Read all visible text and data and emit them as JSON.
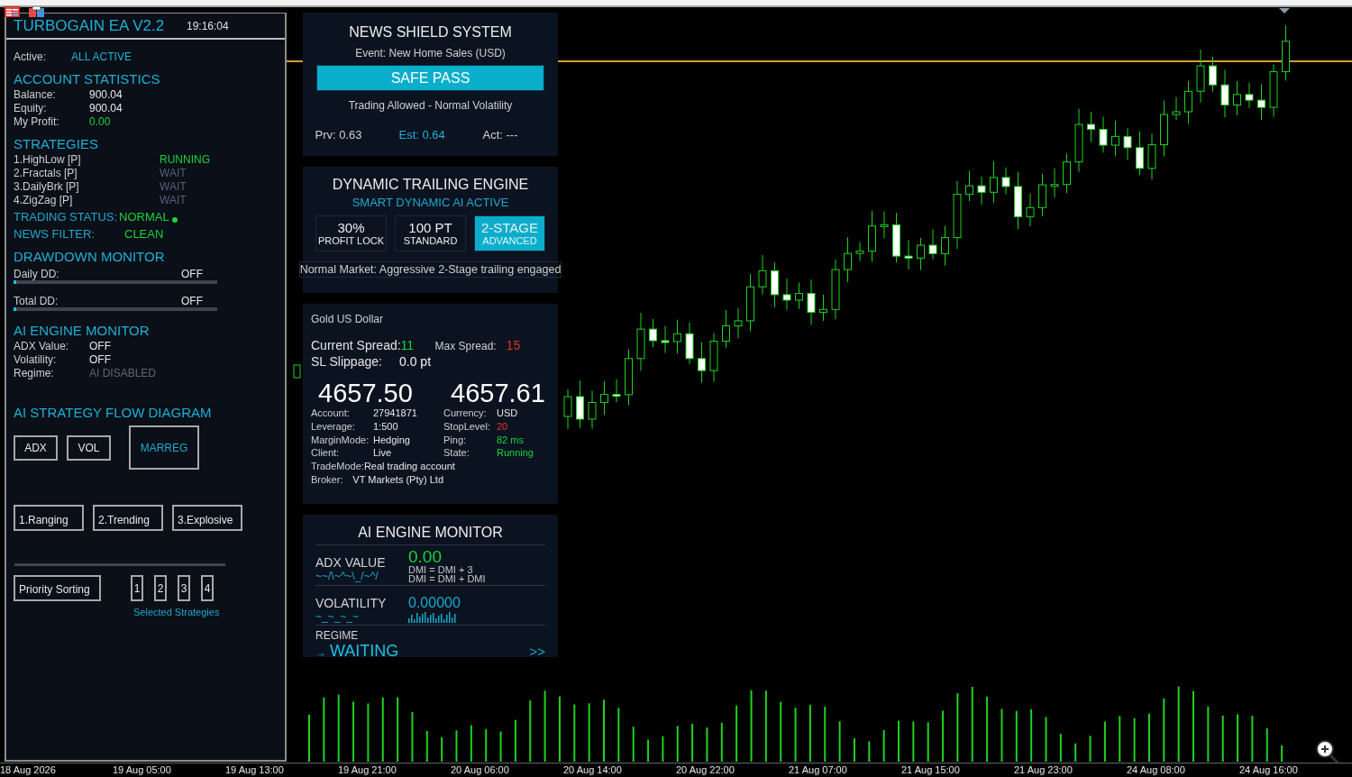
{
  "panel": {
    "title": "TURBOGAIN EA V2.2",
    "time": "19:16:04",
    "active_label": "Active:",
    "active_value": "ALL ACTIVE",
    "account": {
      "heading": "ACCOUNT STATISTICS",
      "rows": [
        {
          "label": "Balance:",
          "value": "900.04",
          "kind": "plain"
        },
        {
          "label": "Equity:",
          "value": "900.04",
          "kind": "plain"
        },
        {
          "label": "My Profit:",
          "value": "0.00",
          "kind": "good"
        }
      ]
    },
    "strategies": {
      "heading": "STRATEGIES",
      "items": [
        {
          "name": "1.HighLow [P]",
          "status": "RUNNING",
          "running": true
        },
        {
          "name": "2.Fractals [P]",
          "status": "WAIT",
          "running": false
        },
        {
          "name": "3.DailyBrk [P]",
          "status": "WAIT",
          "running": false
        },
        {
          "name": "4.ZigZag [P]",
          "status": "WAIT",
          "running": false
        }
      ]
    },
    "trading_status": {
      "label": "TRADING STATUS:",
      "value": "NORMAL"
    },
    "news_filter": {
      "label": "NEWS FILTER:",
      "value": "CLEAN"
    },
    "drawdown": {
      "heading": "DRAWDOWN MONITOR",
      "meters": [
        {
          "label": "Daily DD:",
          "reading": "OFF",
          "level": 0.01
        },
        {
          "label": "Total DD:",
          "reading": "OFF",
          "level": 0.01
        }
      ]
    },
    "ai_monitor": {
      "heading": "AI ENGINE MONITOR",
      "rows": [
        {
          "label": "ADX Value:",
          "value": "OFF",
          "disabled": false
        },
        {
          "label": "Volatility:",
          "value": "OFF",
          "disabled": false
        },
        {
          "label": "Regime:",
          "value": "AI DISABLED",
          "disabled": true
        }
      ]
    },
    "flow": {
      "heading": "AI STRATEGY FLOW DIAGRAM",
      "inputs": [
        "ADX",
        "VOL"
      ],
      "core": "MARREG",
      "regimes": [
        "1.Ranging",
        "2.Trending",
        "3.Explosive"
      ],
      "sort_label": "Priority Sorting",
      "slots": [
        "1",
        "2",
        "3",
        "4"
      ],
      "slots_caption": "Selected Strategies"
    }
  },
  "news": {
    "title": "NEWS SHIELD SYSTEM",
    "event": "Event: New Home Sales (USD)",
    "verdict": "SAFE PASS",
    "note": "Trading Allowed - Normal Volatility",
    "figures": [
      {
        "text": "Prv: 0.63",
        "highlight": false
      },
      {
        "text": "Est: 0.64",
        "highlight": true
      },
      {
        "text": "Act: ---",
        "highlight": false
      }
    ]
  },
  "trailing": {
    "title": "DYNAMIC TRAILING ENGINE",
    "subtitle": "SMART DYNAMIC AI ACTIVE",
    "modes": [
      {
        "value": "30%",
        "label": "PROFIT LOCK",
        "selected": false
      },
      {
        "value": "100 PT",
        "label": "STANDARD",
        "selected": false
      },
      {
        "value": "2-STAGE",
        "label": "ADVANCED",
        "selected": true
      }
    ],
    "message": "Normal Market: Aggressive 2-Stage trailing engaged"
  },
  "info": {
    "symbol": "Gold US Dollar",
    "spread": {
      "label": "Current Spread:",
      "value": "11"
    },
    "max_spread": {
      "label": "Max Spread:",
      "value": "15"
    },
    "slippage": {
      "label": "SL Slippage:",
      "value": "0.0 pt"
    },
    "bid": "4657.50",
    "ask": "4657.61",
    "left": [
      {
        "label": "Account:",
        "value": "27941871"
      },
      {
        "label": "Leverage:",
        "value": "1:500"
      },
      {
        "label": "MarginMode:",
        "value": "Hedging"
      },
      {
        "label": "Client:",
        "value": "Live"
      },
      {
        "label": "TradeMode:",
        "value": "Real trading account"
      },
      {
        "label": "Broker:",
        "value": "VT Markets (Pty) Ltd"
      }
    ],
    "right": [
      {
        "label": "Currency:",
        "value": "USD",
        "kind": "plain"
      },
      {
        "label": "StopLevel:",
        "value": "20",
        "kind": "alert"
      },
      {
        "label": "Ping:",
        "value": "82 ms",
        "kind": "good"
      },
      {
        "label": "State:",
        "value": "Running",
        "kind": "good"
      }
    ]
  },
  "ai": {
    "title": "AI ENGINE MONITOR",
    "adx": {
      "label": "ADX VALUE",
      "value": "0.00",
      "wave": "~~/\\~^~\\_/~^/",
      "formulas": [
        "DMI = DMI + 3",
        "DMI = DMI + DMI"
      ]
    },
    "volatility": {
      "label": "VOLATILITY",
      "value": "0.00000",
      "wave": "~_~_~_~"
    },
    "regime": {
      "label": "REGIME",
      "arrow": "→",
      "value": "WAITING",
      "more": ">>"
    }
  },
  "time_axis": [
    "18 Aug 2026",
    "19 Aug 05:00",
    "19 Aug 13:00",
    "19 Aug 21:00",
    "20 Aug 06:00",
    "20 Aug 14:00",
    "20 Aug 22:00",
    "21 Aug 07:00",
    "21 Aug 15:00",
    "21 Aug 23:00",
    "24 Aug 08:00",
    "24 Aug 16:00"
  ]
}
